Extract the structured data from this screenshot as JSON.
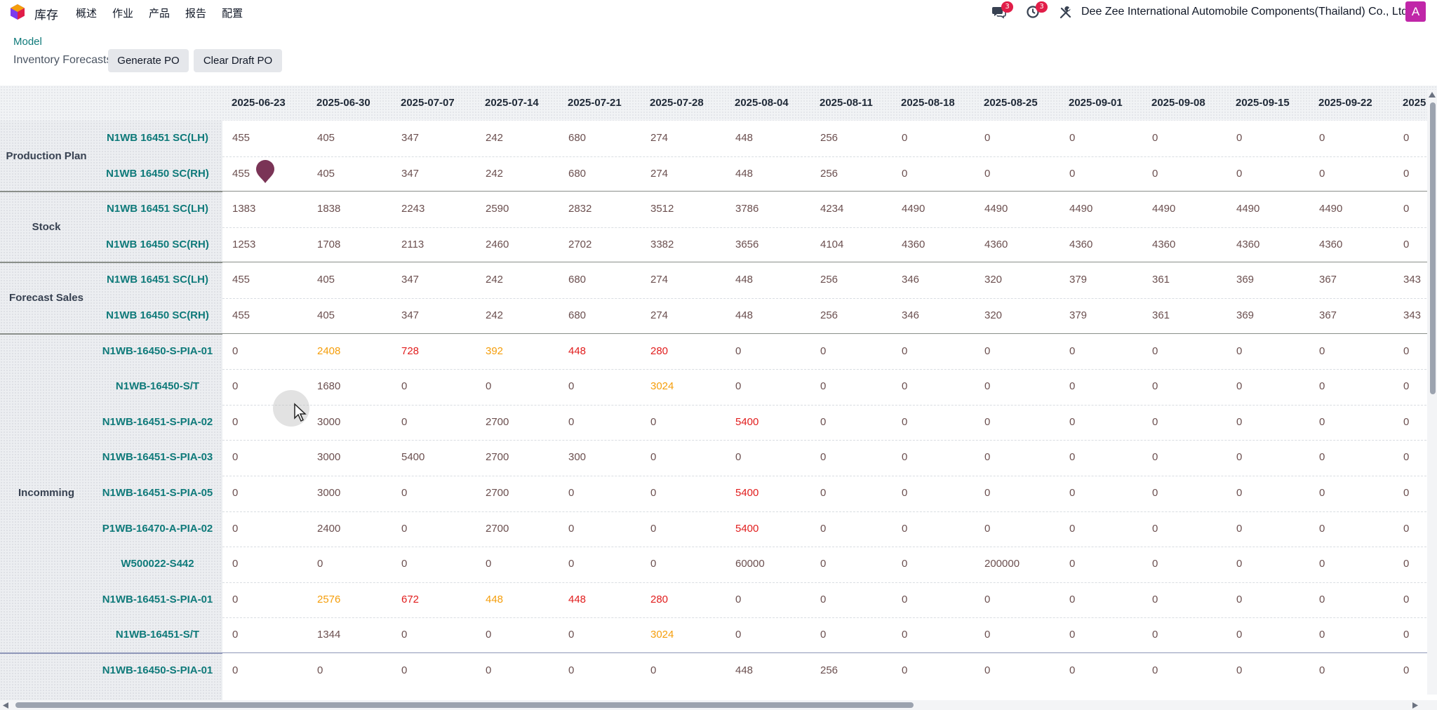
{
  "navbar": {
    "app_name": "库存",
    "menu": [
      "概述",
      "作业",
      "产品",
      "报告",
      "配置"
    ],
    "messages_badge": "3",
    "activities_badge": "3",
    "company": "Dee Zee International Automobile Components(Thailand) Co., Ltd.",
    "avatar_letter": "A",
    "brand_color": "#c026a8"
  },
  "control_panel": {
    "breadcrumb": "Model",
    "subtitle": "Inventory Forecasts",
    "generate_po": "Generate PO",
    "clear_draft_po": "Clear Draft PO"
  },
  "grid": {
    "columns": [
      "2025-06-23",
      "2025-06-30",
      "2025-07-07",
      "2025-07-14",
      "2025-07-21",
      "2025-07-28",
      "2025-08-04",
      "2025-08-11",
      "2025-08-18",
      "2025-08-25",
      "2025-09-01",
      "2025-09-08",
      "2025-09-15",
      "2025-09-22",
      "2025"
    ],
    "groups": [
      {
        "label": "Production Plan",
        "rows": [
          {
            "label": "N1WB 16451 SC(LH)",
            "values": [
              "455",
              "405",
              "347",
              "242",
              "680",
              "274",
              "448",
              "256",
              "0",
              "0",
              "0",
              "0",
              "0",
              "0",
              "0"
            ]
          },
          {
            "label": "N1WB 16450 SC(RH)",
            "values": [
              "455",
              "405",
              "347",
              "242",
              "680",
              "274",
              "448",
              "256",
              "0",
              "0",
              "0",
              "0",
              "0",
              "0",
              "0"
            ]
          }
        ]
      },
      {
        "label": "Stock",
        "rows": [
          {
            "label": "N1WB 16451 SC(LH)",
            "values": [
              "1383",
              "1838",
              "2243",
              "2590",
              "2832",
              "3512",
              "3786",
              "4234",
              "4490",
              "4490",
              "4490",
              "4490",
              "4490",
              "4490",
              "0"
            ]
          },
          {
            "label": "N1WB 16450 SC(RH)",
            "values": [
              "1253",
              "1708",
              "2113",
              "2460",
              "2702",
              "3382",
              "3656",
              "4104",
              "4360",
              "4360",
              "4360",
              "4360",
              "4360",
              "4360",
              "0"
            ]
          }
        ]
      },
      {
        "label": "Forecast Sales",
        "rows": [
          {
            "label": "N1WB 16451 SC(LH)",
            "values": [
              "455",
              "405",
              "347",
              "242",
              "680",
              "274",
              "448",
              "256",
              "346",
              "320",
              "379",
              "361",
              "369",
              "367",
              "343"
            ]
          },
          {
            "label": "N1WB 16450 SC(RH)",
            "values": [
              "455",
              "405",
              "347",
              "242",
              "680",
              "274",
              "448",
              "256",
              "346",
              "320",
              "379",
              "361",
              "369",
              "367",
              "343"
            ]
          }
        ]
      },
      {
        "label": "Incomming",
        "rows": [
          {
            "label": "N1WB-16450-S-PIA-01",
            "values": [
              "0",
              "2408",
              "728",
              "392",
              "448",
              "280",
              "0",
              "0",
              "0",
              "0",
              "0",
              "0",
              "0",
              "0",
              "0"
            ],
            "colors": [
              "",
              "orange",
              "red",
              "orange",
              "red",
              "red",
              "",
              "",
              "",
              "",
              "",
              "",
              "",
              "",
              ""
            ]
          },
          {
            "label": "N1WB-16450-S/T",
            "values": [
              "0",
              "1680",
              "0",
              "0",
              "0",
              "3024",
              "0",
              "0",
              "0",
              "0",
              "0",
              "0",
              "0",
              "0",
              "0"
            ],
            "colors": [
              "",
              "",
              "",
              "",
              "",
              "orange",
              "",
              "",
              "",
              "",
              "",
              "",
              "",
              "",
              ""
            ]
          },
          {
            "label": "N1WB-16451-S-PIA-02",
            "values": [
              "0",
              "3000",
              "0",
              "2700",
              "0",
              "0",
              "5400",
              "0",
              "0",
              "0",
              "0",
              "0",
              "0",
              "0",
              "0"
            ],
            "colors": [
              "",
              "",
              "",
              "",
              "",
              "",
              "red",
              "",
              "",
              "",
              "",
              "",
              "",
              "",
              ""
            ]
          },
          {
            "label": "N1WB-16451-S-PIA-03",
            "values": [
              "0",
              "3000",
              "5400",
              "2700",
              "300",
              "0",
              "0",
              "0",
              "0",
              "0",
              "0",
              "0",
              "0",
              "0",
              "0"
            ],
            "colors": [
              "",
              "",
              "",
              "",
              "",
              "",
              "",
              "",
              "",
              "",
              "",
              "",
              "",
              "",
              ""
            ]
          },
          {
            "label": "N1WB-16451-S-PIA-05",
            "values": [
              "0",
              "3000",
              "0",
              "2700",
              "0",
              "0",
              "5400",
              "0",
              "0",
              "0",
              "0",
              "0",
              "0",
              "0",
              "0"
            ],
            "colors": [
              "",
              "",
              "",
              "",
              "",
              "",
              "red",
              "",
              "",
              "",
              "",
              "",
              "",
              "",
              ""
            ]
          },
          {
            "label": "P1WB-16470-A-PIA-02",
            "values": [
              "0",
              "2400",
              "0",
              "2700",
              "0",
              "0",
              "5400",
              "0",
              "0",
              "0",
              "0",
              "0",
              "0",
              "0",
              "0"
            ],
            "colors": [
              "",
              "",
              "",
              "",
              "",
              "",
              "red",
              "",
              "",
              "",
              "",
              "",
              "",
              "",
              ""
            ]
          },
          {
            "label": "W500022-S442",
            "values": [
              "0",
              "0",
              "0",
              "0",
              "0",
              "0",
              "60000",
              "0",
              "0",
              "200000",
              "0",
              "0",
              "0",
              "0",
              "0"
            ],
            "colors": [
              "",
              "",
              "",
              "",
              "",
              "",
              "",
              "",
              "",
              "",
              "",
              "",
              "",
              "",
              ""
            ]
          },
          {
            "label": "N1WB-16451-S-PIA-01",
            "values": [
              "0",
              "2576",
              "672",
              "448",
              "448",
              "280",
              "0",
              "0",
              "0",
              "0",
              "0",
              "0",
              "0",
              "0",
              "0"
            ],
            "colors": [
              "",
              "orange",
              "red",
              "orange",
              "red",
              "red",
              "",
              "",
              "",
              "",
              "",
              "",
              "",
              "",
              ""
            ]
          },
          {
            "label": "N1WB-16451-S/T",
            "values": [
              "0",
              "1344",
              "0",
              "0",
              "0",
              "3024",
              "0",
              "0",
              "0",
              "0",
              "0",
              "0",
              "0",
              "0",
              "0"
            ],
            "colors": [
              "",
              "",
              "",
              "",
              "",
              "orange",
              "",
              "",
              "",
              "",
              "",
              "",
              "",
              "",
              ""
            ]
          }
        ]
      },
      {
        "label": "",
        "rows": [
          {
            "label": "N1WB-16450-S-PIA-01",
            "values": [
              "0",
              "0",
              "0",
              "0",
              "0",
              "0",
              "448",
              "256",
              "0",
              "0",
              "0",
              "0",
              "0",
              "0",
              "0"
            ],
            "colors": [
              "",
              "",
              "",
              "",
              "",
              "",
              "",
              "",
              "",
              "",
              "",
              "",
              "",
              "",
              ""
            ]
          }
        ]
      }
    ]
  },
  "colors": {
    "accent": "#0f7a7a",
    "value_default": "#6b4f4f",
    "value_orange": "#f59e0b",
    "value_red": "#e11d1d"
  }
}
